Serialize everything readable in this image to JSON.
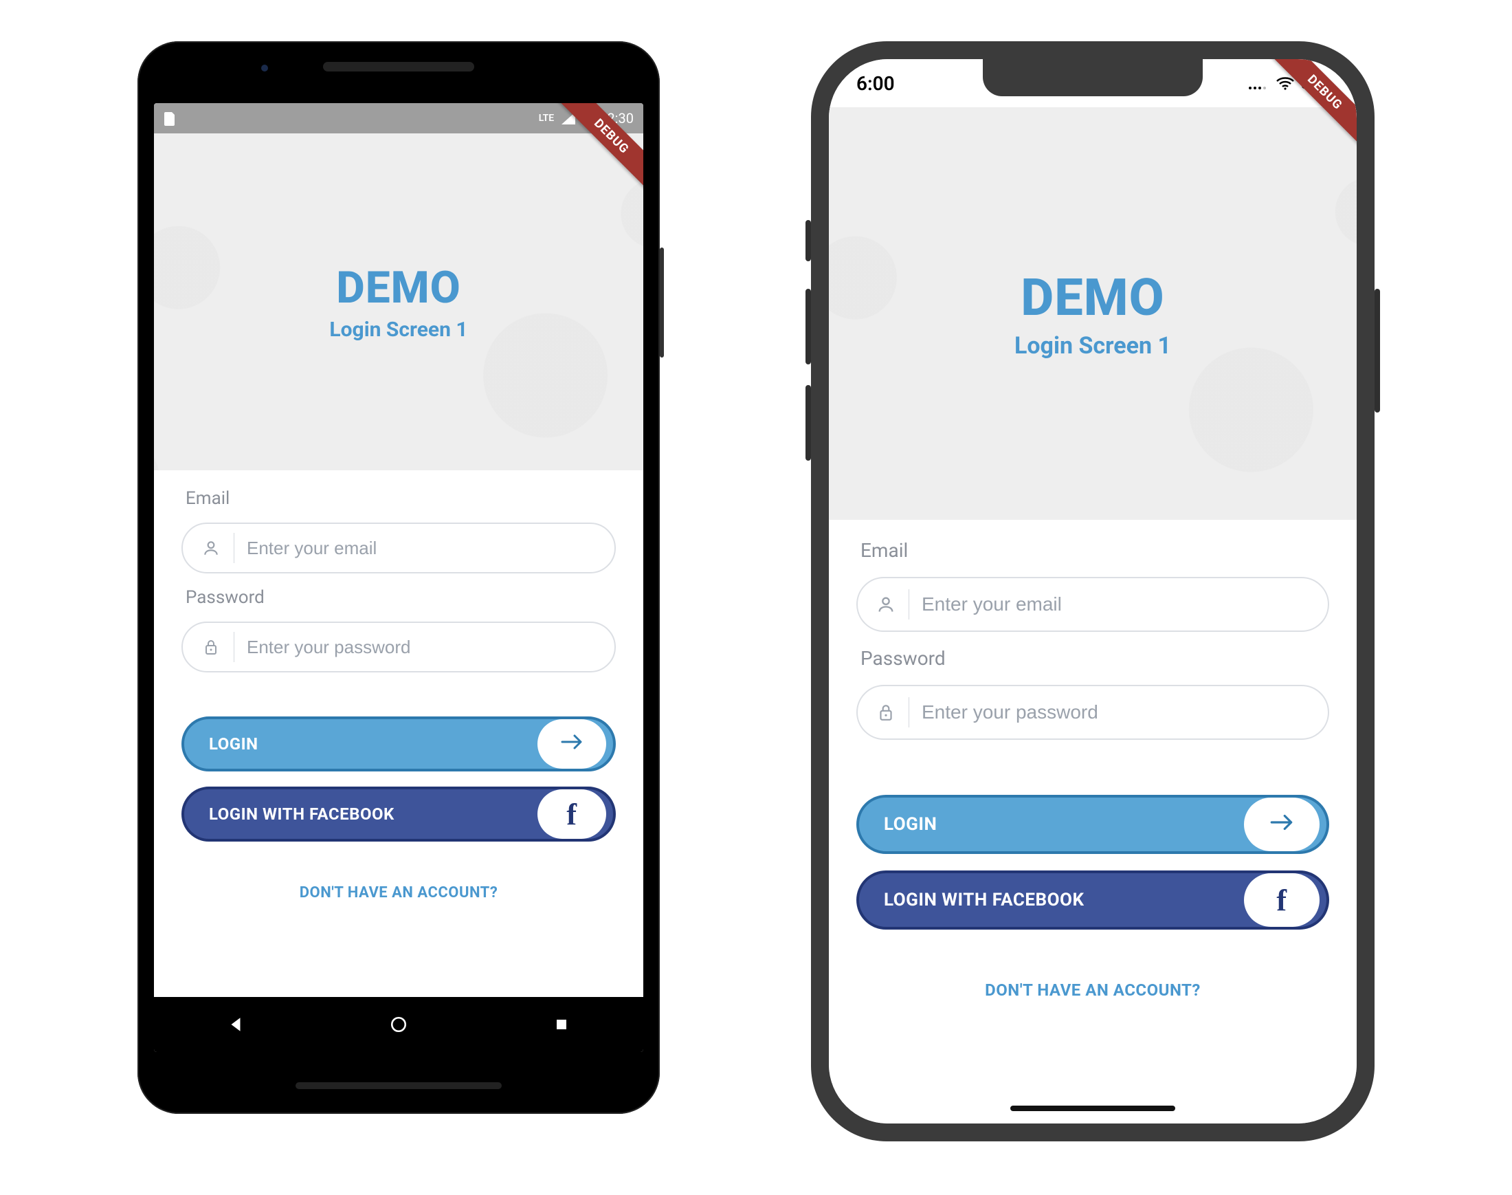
{
  "debug_banner": "DEBUG",
  "hero": {
    "title": "DEMO",
    "subtitle": "Login Screen 1"
  },
  "form": {
    "email_label": "Email",
    "email_placeholder": "Enter your email",
    "email_value": "",
    "password_label": "Password",
    "password_placeholder": "Enter your password",
    "password_value": ""
  },
  "buttons": {
    "login": "LOGIN",
    "facebook": "LOGIN WITH FACEBOOK",
    "facebook_glyph": "f"
  },
  "signup_link": "DON'T HAVE AN ACCOUNT?",
  "android_status": {
    "time": "12:30",
    "net_label": "LTE"
  },
  "ios_status": {
    "time": "6:00"
  },
  "colors": {
    "primary": "#4a98cf",
    "login_bg": "#5aa6d6",
    "login_border": "#2d79ad",
    "fb_bg": "#3e549a",
    "fb_border": "#223574",
    "field_border": "#dcdfe4",
    "muted_text": "#8a8f98"
  }
}
